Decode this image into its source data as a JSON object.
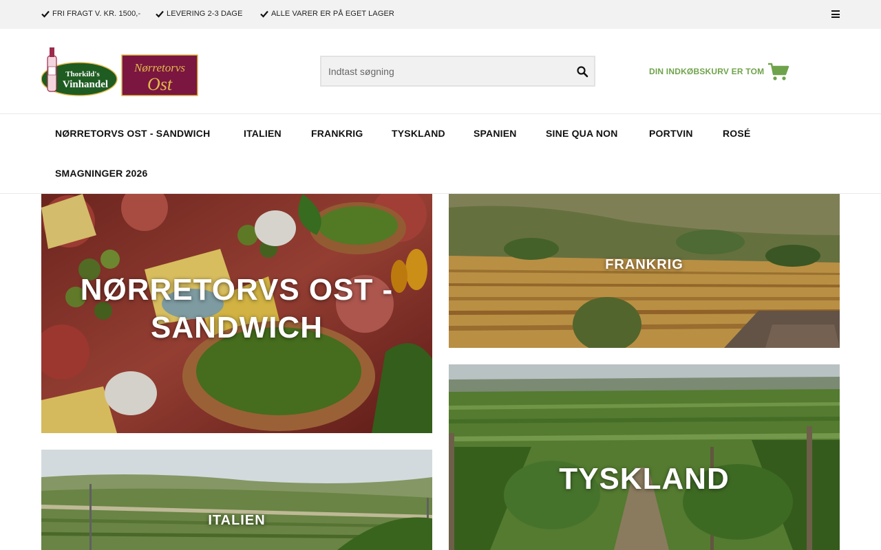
{
  "topbar": {
    "usps": [
      "FRI FRAGT V. KR. 1500,-",
      "LEVERING 2-3 DAGE",
      "ALLE VARER ER PÅ EGET LAGER"
    ]
  },
  "header": {
    "logo_left_text_1": "Thorkild's",
    "logo_left_text_2": "Vinhandel",
    "logo_right_text_1": "Nørretorvs",
    "logo_right_text_2": "Ost",
    "search_placeholder": "Indtast søgning",
    "cart_label": "DIN INDKØBSKURV ER TOM"
  },
  "nav": {
    "items": [
      "NØRRETORVS OST - SANDWICH",
      "ITALIEN",
      "FRANKRIG",
      "TYSKLAND",
      "SPANIEN",
      "SINE QUA NON",
      "PORTVIN",
      "ROSÉ",
      "SMAGNINGER 2026"
    ]
  },
  "tiles": {
    "sandwich": "NØRRETORVS OST - SANDWICH",
    "frankrig": "FRANKRIG",
    "italien": "ITALIEN",
    "tyskland": "TYSKLAND"
  },
  "colors": {
    "accent_green": "#6fa34b",
    "logo_green": "#1f5c22",
    "logo_maroon": "#7a1640",
    "logo_gold": "#e3b94a"
  }
}
